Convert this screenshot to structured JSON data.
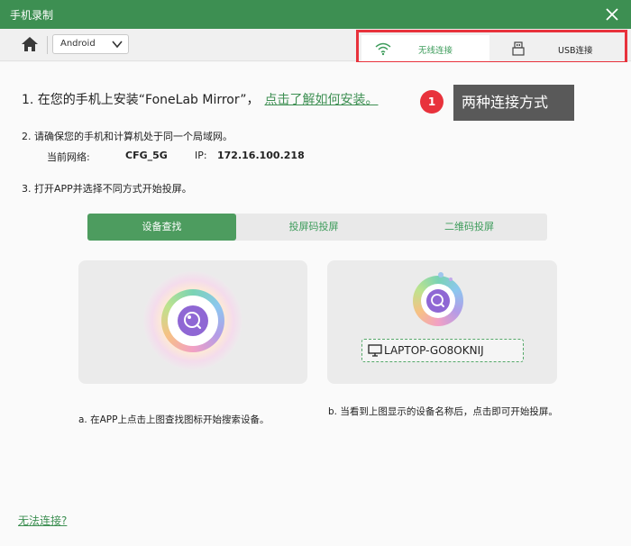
{
  "window": {
    "title": "手机录制"
  },
  "toolbar": {
    "platform": "Android"
  },
  "connection_tabs": {
    "wireless": "无线连接",
    "usb": "USB连接"
  },
  "steps": {
    "step1_text": "1. 在您的手机上安装“FoneLab Mirror”，",
    "step1_link": "点击了解如何安装。",
    "step2_text": "2. 请确保您的手机和计算机处于同一个局域网。",
    "network_label": "当前网络:",
    "network_value": "CFG_5G",
    "ip_label": "IP:",
    "ip_value": "172.16.100.218",
    "step3_text": "3. 打开APP并选择不同方式开始投屏。"
  },
  "annotation": {
    "number": "1",
    "text": "两种连接方式"
  },
  "mode_tabs": {
    "device_search": "设备查找",
    "cast_code": "投屏码投屏",
    "qr_code": "二维码投屏"
  },
  "device": {
    "name": "LAPTOP-GO8OKNIJ"
  },
  "descriptions": {
    "a": "a. 在APP上点击上图查找图标开始搜索设备。",
    "b": "b. 当看到上图显示的设备名称后，点击即可开始投屏。"
  },
  "footer": {
    "cant_connect": "无法连接?"
  },
  "colors": {
    "brand_green": "#3d8f52",
    "highlight_red": "#e8323c",
    "callout_gray": "#595959"
  },
  "icons": {
    "close": "close-icon",
    "home": "home-icon",
    "dropdown": "chevron-down-icon",
    "wifi": "wifi-icon",
    "usb": "usb-icon",
    "search": "search-icon",
    "monitor": "monitor-icon"
  }
}
